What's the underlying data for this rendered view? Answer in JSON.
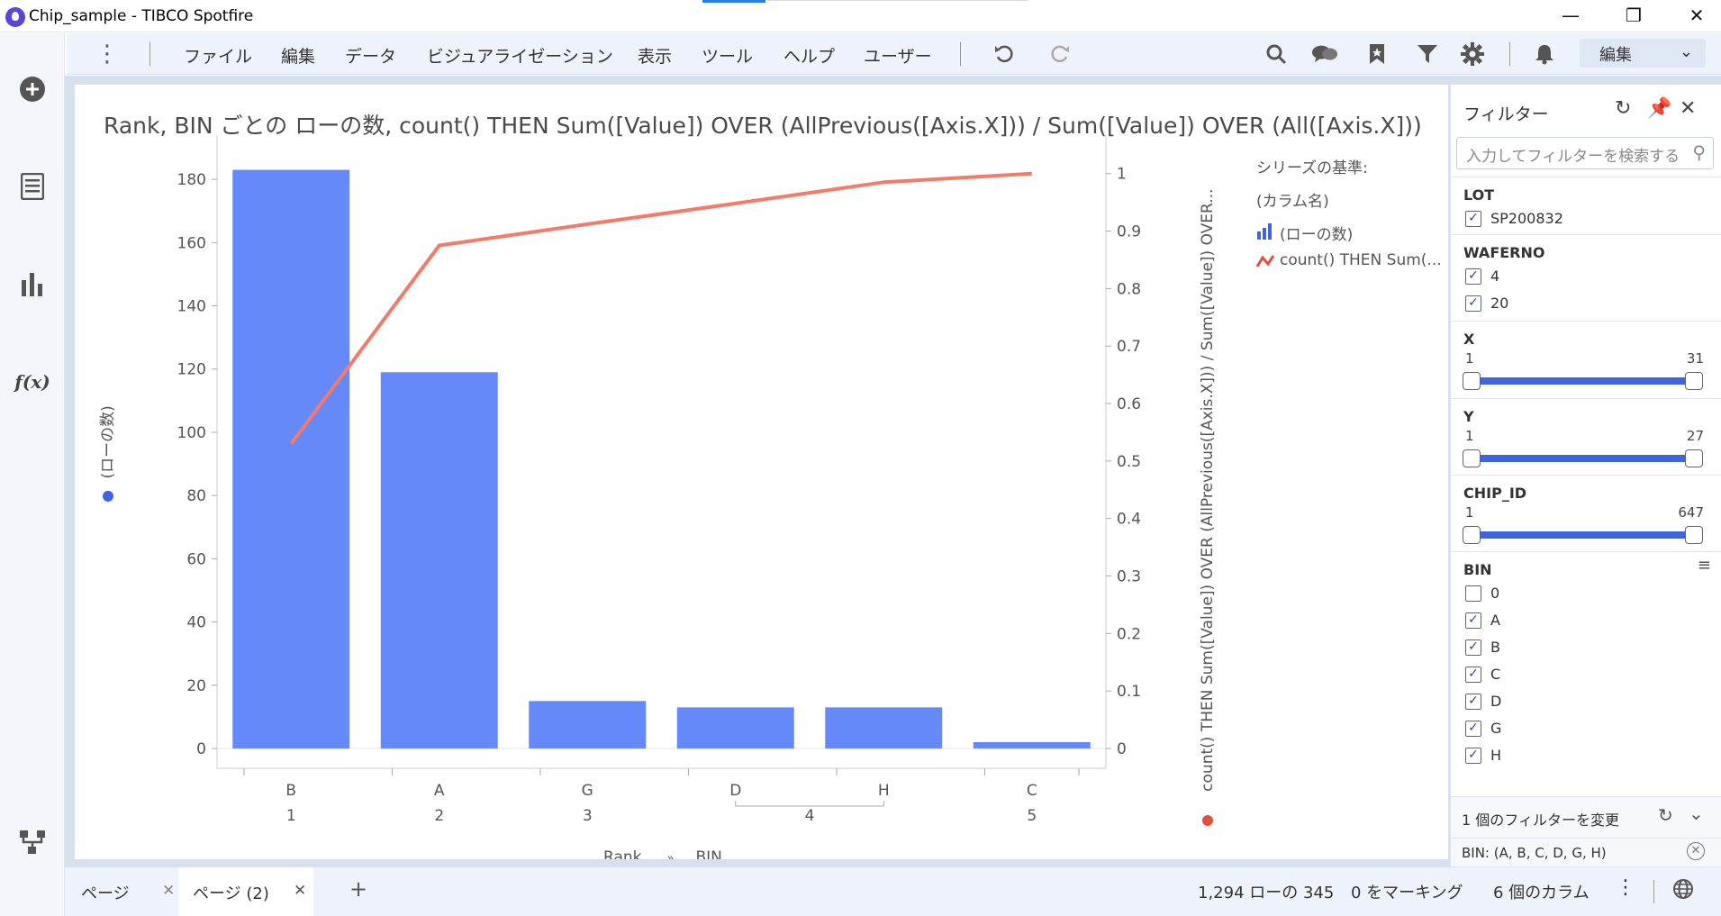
{
  "window": {
    "title": "Chip_sample - TIBCO Spotfire"
  },
  "menu": {
    "items": [
      "ファイル",
      "編集",
      "データ",
      "ビジュアライゼーション",
      "表示",
      "ツール",
      "ヘルプ",
      "ユーザー"
    ],
    "edit_mode": "編集"
  },
  "visualization": {
    "title": "Rank, BIN ごとの ローの数, count() THEN Sum([Value]) OVER (AllPrevious([Axis.X])) / Sum([Value]) OVER (All([Axis.X]))"
  },
  "chart_data": {
    "type": "bar",
    "categories": [
      "B",
      "A",
      "G",
      "D",
      "H",
      "C"
    ],
    "rank_groups": [
      {
        "rank": "1",
        "bins": [
          "B"
        ]
      },
      {
        "rank": "2",
        "bins": [
          "A"
        ]
      },
      {
        "rank": "3",
        "bins": [
          "G"
        ]
      },
      {
        "rank": "4",
        "bins": [
          "D",
          "H"
        ]
      },
      {
        "rank": "5",
        "bins": [
          "C"
        ]
      }
    ],
    "series": [
      {
        "name": "(ローの数)",
        "type": "bar",
        "axis": "left",
        "values": [
          183,
          119,
          15,
          13,
          13,
          2
        ]
      },
      {
        "name": "count() THEN Sum(...",
        "type": "line",
        "axis": "right",
        "values": [
          0.53,
          0.875,
          0.912,
          0.948,
          0.985,
          1.0
        ]
      }
    ],
    "y_left": {
      "label": "(ローの数)",
      "ticks": [
        0,
        20,
        40,
        60,
        80,
        100,
        120,
        140,
        160,
        180
      ],
      "ylim": [
        0,
        190
      ]
    },
    "y_right": {
      "label": "count() THEN Sum([Value]) OVER (AllPrevious([Axis.X])) / Sum([Value]) OVER...",
      "ticks": [
        0,
        0.1,
        0.2,
        0.3,
        0.4,
        0.5,
        0.6,
        0.7,
        0.8,
        0.9,
        1
      ],
      "ylim": [
        0,
        1.045
      ]
    },
    "x_label_parts": [
      "Rank",
      "»",
      "BIN"
    ],
    "colors": {
      "bar": "#6589f8",
      "line": "#f47a6a"
    },
    "legend": {
      "title": "シリーズの基準:",
      "subtitle": "(カラム名)",
      "position": "right"
    }
  },
  "filters": {
    "title": "フィルター",
    "search_placeholder": "入力してフィルターを検索する",
    "groups": [
      {
        "name": "LOT",
        "type": "checkbox",
        "items": [
          {
            "label": "SP200832",
            "checked": true
          }
        ]
      },
      {
        "name": "WAFERNO",
        "type": "checkbox",
        "items": [
          {
            "label": "4",
            "checked": true
          },
          {
            "label": "20",
            "checked": true
          }
        ]
      },
      {
        "name": "X",
        "type": "range",
        "min": "1",
        "max": "31"
      },
      {
        "name": "Y",
        "type": "range",
        "min": "1",
        "max": "27"
      },
      {
        "name": "CHIP_ID",
        "type": "range",
        "min": "1",
        "max": "647"
      },
      {
        "name": "BIN",
        "type": "checkbox",
        "items": [
          {
            "label": "0",
            "checked": false
          },
          {
            "label": "A",
            "checked": true
          },
          {
            "label": "B",
            "checked": true
          },
          {
            "label": "C",
            "checked": true
          },
          {
            "label": "D",
            "checked": true
          },
          {
            "label": "G",
            "checked": true
          },
          {
            "label": "H",
            "checked": true
          }
        ]
      }
    ],
    "changed_summary": "1 個のフィルターを変更",
    "active_filter": "BIN: (A, B, C, D, G, H)"
  },
  "pages": [
    {
      "label": "ページ",
      "active": false
    },
    {
      "label": "ページ (2)",
      "active": true
    }
  ],
  "status": {
    "rows": "1,294 ローの 345",
    "marking": "0 をマーキング",
    "columns": "6 個のカラム"
  }
}
